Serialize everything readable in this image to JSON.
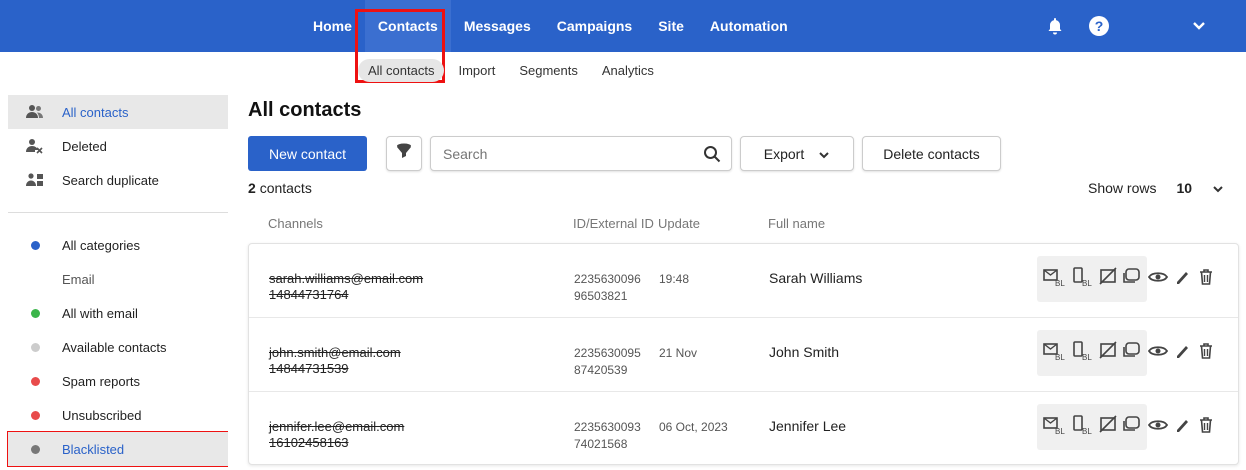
{
  "topnav": {
    "items": [
      "Home",
      "Contacts",
      "Messages",
      "Campaigns",
      "Site",
      "Automation"
    ],
    "active_index": 1
  },
  "subnav": {
    "items": [
      "All contacts",
      "Import",
      "Segments",
      "Analytics"
    ],
    "active_index": 0
  },
  "sidebar": {
    "top_items": [
      {
        "label": "All contacts",
        "icon": "people-icon"
      },
      {
        "label": "Deleted",
        "icon": "person-x-icon"
      },
      {
        "label": "Search duplicate",
        "icon": "duplicate-icon"
      }
    ],
    "all_categories": "All categories",
    "group_label": "Email",
    "categories": [
      {
        "label": "All with email",
        "color": "#3bb54a"
      },
      {
        "label": "Available contacts",
        "color": "#cccccc"
      },
      {
        "label": "Spam reports",
        "color": "#e84b4b"
      },
      {
        "label": "Unsubscribed",
        "color": "#e84b4b"
      },
      {
        "label": "Blacklisted",
        "color": "#777777"
      }
    ]
  },
  "main": {
    "title": "All contacts",
    "new_contact": "New contact",
    "search_placeholder": "Search",
    "export": "Export",
    "delete_contacts": "Delete contacts",
    "count_num": "2",
    "count_label": "contacts",
    "show_rows_label": "Show rows",
    "show_rows_value": "10",
    "columns": [
      "Channels",
      "ID/External ID",
      "Update",
      "Full name"
    ]
  },
  "rows": [
    {
      "email": "sarah.williams@email.com",
      "phone": "14844731764",
      "id": "2235630096",
      "ext_id": "96503821",
      "update": "19:48",
      "name": "Sarah Williams"
    },
    {
      "email": "john.smith@email.com",
      "phone": "14844731539",
      "id": "2235630095",
      "ext_id": "87420539",
      "update": "21 Nov",
      "name": "John Smith"
    },
    {
      "email": "jennifer.lee@email.com",
      "phone": "16102458163",
      "id": "2235630093",
      "ext_id": "74021568",
      "update": "06 Oct, 2023",
      "name": "Jennifer Lee"
    }
  ],
  "colors": {
    "brand": "#2a62c9",
    "highlight": "#e11111"
  }
}
